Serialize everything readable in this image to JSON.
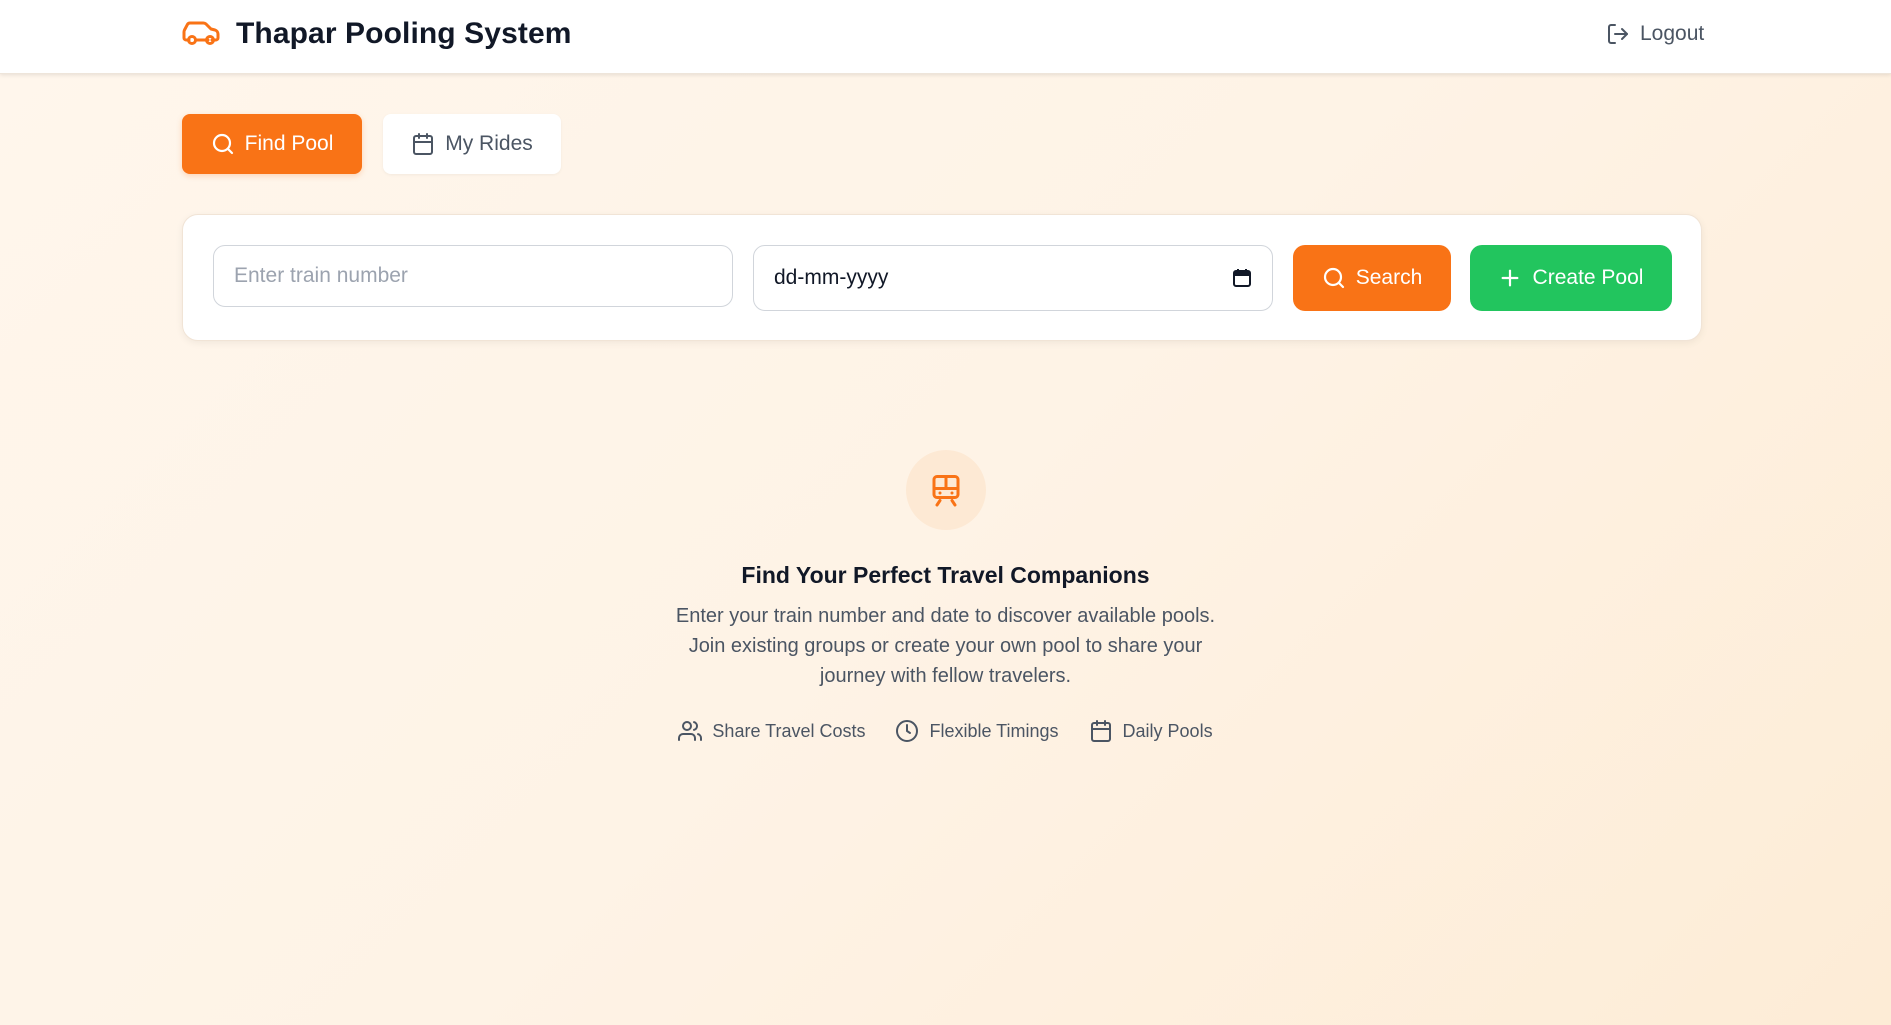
{
  "header": {
    "title": "Thapar Pooling System",
    "logo_icon": "car-icon",
    "logout_label": "Logout",
    "logout_icon": "logout-icon"
  },
  "tabs": [
    {
      "label": "Find Pool",
      "icon": "search-icon",
      "active": true
    },
    {
      "label": "My Rides",
      "icon": "calendar-icon",
      "active": false
    }
  ],
  "search": {
    "train_placeholder": "Enter train number",
    "train_value": "",
    "date_placeholder": "dd-mm-yyyy",
    "date_icon": "calendar-picker-icon",
    "search_label": "Search",
    "create_label": "Create Pool"
  },
  "empty_state": {
    "icon": "train-icon",
    "title": "Find Your Perfect Travel Companions",
    "description": "Enter your train number and date to discover available pools. Join existing groups or create your own pool to share your journey with fellow travelers.",
    "features": [
      {
        "label": "Share Travel Costs",
        "icon": "users-icon"
      },
      {
        "label": "Flexible Timings",
        "icon": "clock-icon"
      },
      {
        "label": "Daily Pools",
        "icon": "calendar-icon"
      }
    ]
  },
  "colors": {
    "accent": "#f97316",
    "success": "#22c55e",
    "text_primary": "#111827",
    "text_secondary": "#4b5563",
    "background": "#fef3e6"
  }
}
